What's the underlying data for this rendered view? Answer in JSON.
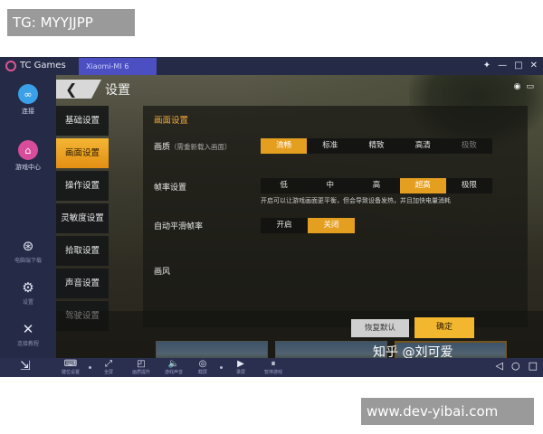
{
  "watermarks": {
    "top": "TG: MYYJJPP",
    "bottom": "www.dev-yibai.com",
    "zhihu": "知乎 @刘可爱"
  },
  "titlebar": {
    "app_name": "TC Games",
    "device_tab": "Xiaomi-MI 6",
    "controls": [
      "✦",
      "—",
      "□",
      "✕"
    ]
  },
  "sidebar": {
    "connect_label": "连接",
    "game_center_label": "游戏中心",
    "download_label": "电脑端下载",
    "settings_label": "设置",
    "tools_label": "连接教程"
  },
  "game_header": {
    "back_glyph": "❮",
    "title": "设置",
    "sys": [
      "◉",
      "▭"
    ]
  },
  "categories": [
    {
      "label": "基础设置",
      "active": false
    },
    {
      "label": "画面设置",
      "active": true
    },
    {
      "label": "操作设置",
      "active": false
    },
    {
      "label": "灵敏度设置",
      "active": false
    },
    {
      "label": "拾取设置",
      "active": false
    },
    {
      "label": "声音设置",
      "active": false
    },
    {
      "label": "驾驶设置",
      "active": false
    }
  ],
  "panel": {
    "section_title": "画面设置",
    "quality": {
      "label": "画质",
      "hint": "（需重新载入画面）",
      "options": [
        "流畅",
        "标准",
        "精致",
        "高清",
        "极致"
      ],
      "selected": "流畅"
    },
    "fps": {
      "label": "帧率设置",
      "options": [
        "低",
        "中",
        "高",
        "超高",
        "极限"
      ],
      "selected": "超高",
      "note": "开启可以让游戏画面更平衡，但会导致设备发热，并且加快电量消耗"
    },
    "smooth": {
      "label": "自动平滑帧率",
      "options": [
        "开启",
        "关闭"
      ],
      "selected": "关闭"
    },
    "style_label": "画风"
  },
  "buttons": {
    "reset": "恢复默认",
    "ok": "确定"
  },
  "toolbar": {
    "items": [
      {
        "icon": "⌨",
        "label": "键位设置"
      },
      {
        "icon": "⤢",
        "label": "全屏"
      },
      {
        "icon": "◰",
        "label": "画质提升"
      },
      {
        "icon": "🔈",
        "label": "游戏声音"
      },
      {
        "icon": "◎",
        "label": "截屏"
      },
      {
        "icon": "▶",
        "label": "录屏"
      },
      {
        "icon": "⏸",
        "label": "暂停游戏"
      }
    ],
    "nav": [
      "◁",
      "○",
      "□"
    ]
  }
}
